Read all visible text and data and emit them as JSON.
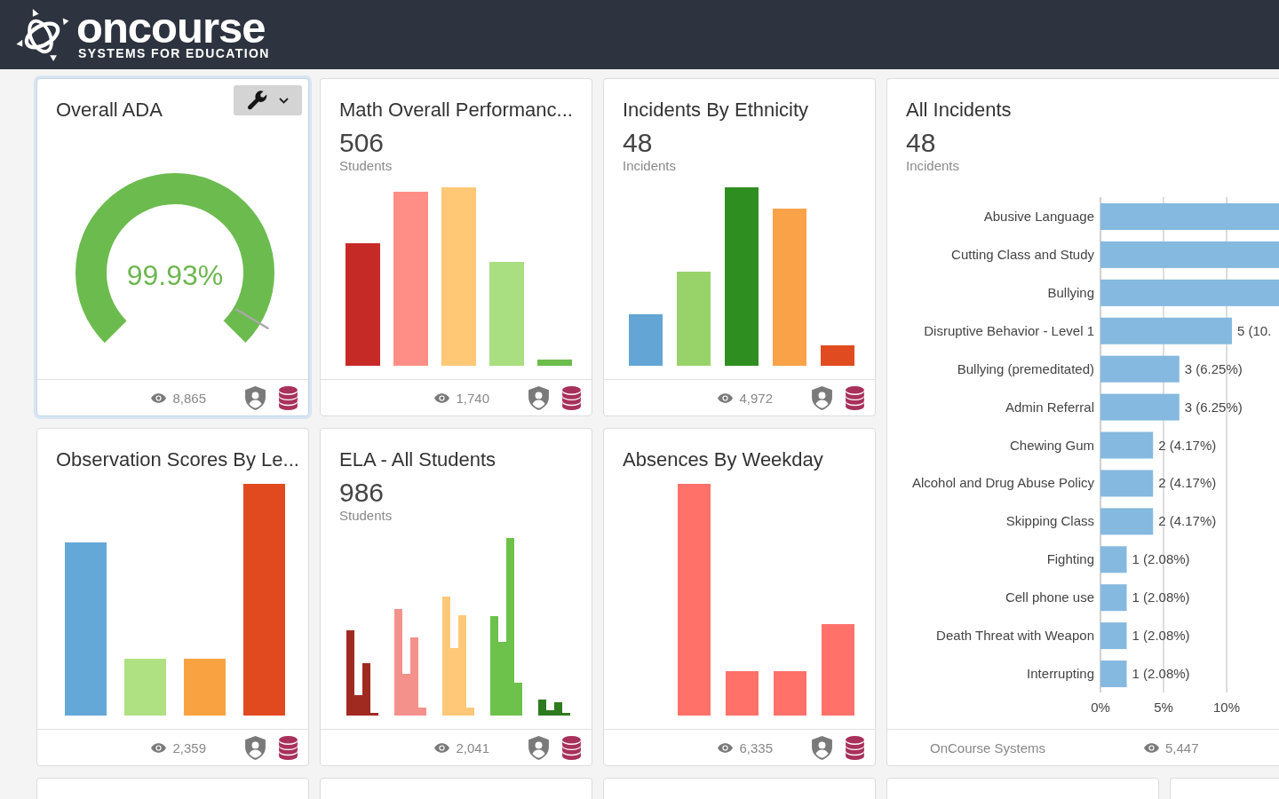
{
  "header": {
    "logo_name": "oncourse",
    "logo_tagline": "SYSTEMS FOR EDUCATION"
  },
  "widgets": [
    {
      "kind": "gauge",
      "title": "Overall ADA",
      "selected": true,
      "gauge": {
        "level": 0.9993,
        "reading": "99.93%"
      },
      "views": "8,865"
    },
    {
      "kind": "bars",
      "title": "Math Overall Performanc...",
      "selected": false,
      "total": "506",
      "total_label": "Students",
      "views": "1,740"
    },
    {
      "kind": "bars",
      "title": "Incidents By Ethnicity",
      "selected": false,
      "total": "48",
      "total_label": "Incidents",
      "views": "4,972"
    },
    {
      "kind": "bars",
      "title": "Observation Scores By Le...",
      "selected": false,
      "views": "2,359"
    },
    {
      "kind": "grouped_bars",
      "title": "ELA - All Students",
      "selected": false,
      "total": "986",
      "total_label": "Students",
      "views": "2,041"
    },
    {
      "kind": "bars",
      "title": "Absences By Weekday",
      "selected": false,
      "views": "6,335"
    }
  ],
  "incidents_panel": {
    "title": "All Incidents",
    "selected": false,
    "total": "48",
    "total_label": "Incidents",
    "chart_data": {
      "type": "bar",
      "orientation": "horizontal",
      "categories": [
        "Abusive Language",
        "Cutting Class and Study",
        "Bullying",
        "Disruptive Behavior - Level 1",
        "Bullying (premeditated)",
        "Admin Referral",
        "Chewing Gum",
        "Alcohol and Drug Abuse Policy",
        "Skipping Class",
        "Fighting",
        "Cell phone use",
        "Death Threat with Weapon",
        "Interrupting"
      ],
      "values": [
        14.15,
        14.15,
        14.15,
        10.42,
        6.25,
        6.25,
        4.17,
        4.17,
        4.17,
        2.08,
        2.08,
        2.08,
        2.08
      ],
      "xlim": [
        0,
        14.15
      ],
      "xticks": [
        {
          "value": 0,
          "label": "0%"
        },
        {
          "value": 5,
          "label": "5%"
        },
        {
          "value": 10,
          "label": "10%"
        }
      ],
      "value_labels": [
        null,
        null,
        null,
        "5 (10.",
        "3 (6.25%)",
        "3 (6.25%)",
        "2 (4.17%)",
        "2 (4.17%)",
        "2 (4.17%)",
        "1 (2.08%)",
        "1 (2.08%)",
        "1 (2.08%)",
        "1 (2.08%)"
      ]
    },
    "source": "OnCourse Systems",
    "views": "5,447"
  },
  "more_widgets": [
    {
      "selected": false
    },
    {
      "selected": false
    },
    {
      "selected": false
    },
    {
      "selected": false
    },
    {
      "selected": false
    }
  ]
}
